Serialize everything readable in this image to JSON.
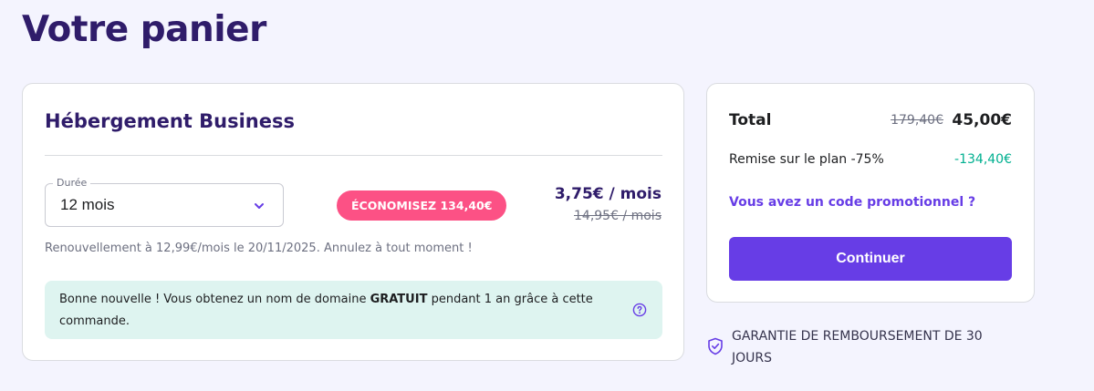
{
  "page": {
    "title": "Votre panier"
  },
  "product": {
    "name": "Hébergement Business",
    "period": {
      "legend": "Durée",
      "selected": "12 mois"
    },
    "save_badge": "ÉCONOMISEZ 134,40€",
    "price_now": "3,75€ / mois",
    "price_old": "14,95€ / mois",
    "renewal": "Renouvellement à 12,99€/mois le 20/11/2025. Annulez à tout moment !",
    "notice": {
      "before": "Bonne nouvelle ! Vous obtenez un nom de domaine ",
      "bold": "GRATUIT",
      "after": " pendant 1 an grâce à cette commande."
    }
  },
  "summary": {
    "total_label": "Total",
    "total_old": "179,40€",
    "total_now": "45,00€",
    "discount_label": "Remise sur le plan -75%",
    "discount_value": "-134,40€",
    "promo_link": "Vous avez un code promotionnel ?",
    "continue_label": "Continuer"
  },
  "guarantee": {
    "text": "GARANTIE DE REMBOURSEMENT DE 30 JOURS"
  },
  "icons": {
    "chevron": "chevron-down-icon",
    "help": "question-circle-icon",
    "shield": "shield-check-icon"
  },
  "colors": {
    "accent": "#673de6",
    "title": "#2f1c6a",
    "badge": "#fc5185",
    "discount": "#00b090",
    "notice_bg": "#def4f0",
    "page_bg": "#f4f4fe"
  }
}
